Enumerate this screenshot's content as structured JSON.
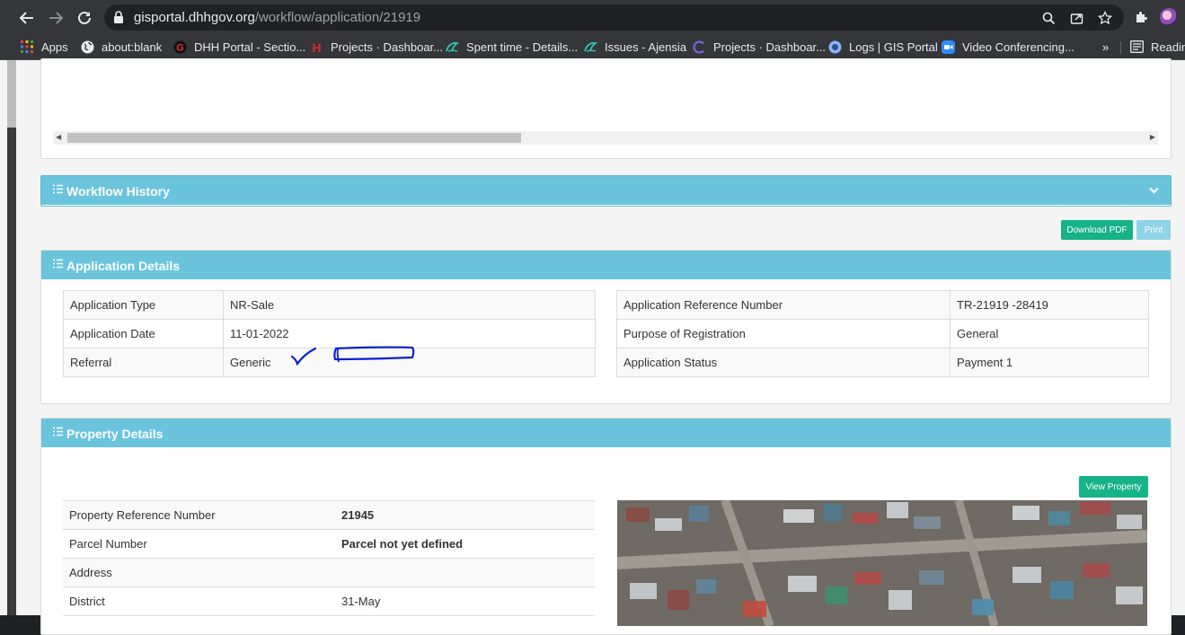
{
  "browser": {
    "url_domain": "gisportal.dhhgov.org",
    "url_path": "/workflow/application/21919",
    "bookmarks": [
      {
        "label": "Apps",
        "icon": "apps-grid-icon"
      },
      {
        "label": "about:blank",
        "icon": "globe-icon"
      },
      {
        "label": "DHH Portal - Sectio...",
        "icon": "dhh-portal-icon"
      },
      {
        "label": "Projects · Dashboar...",
        "icon": "gitlab-red-icon"
      },
      {
        "label": "Spent time - Details...",
        "icon": "ajensia-icon"
      },
      {
        "label": "Issues - Ajensia",
        "icon": "ajensia-icon"
      },
      {
        "label": "Projects · Dashboar...",
        "icon": "purple-c-icon"
      },
      {
        "label": "Logs | GIS Portal",
        "icon": "gis-portal-icon"
      },
      {
        "label": "Video Conferencing...",
        "icon": "zoom-icon"
      }
    ],
    "overflow": "»",
    "reading_list": "Reading"
  },
  "workflow": {
    "title": "Workflow History"
  },
  "actions": {
    "download_pdf": "Download PDF",
    "print": "Print"
  },
  "application": {
    "title": "Application Details",
    "left": [
      {
        "label": "Application Type",
        "value": "NR-Sale"
      },
      {
        "label": "Application Date",
        "value": "11-01-2022"
      },
      {
        "label": "Referral",
        "value": "Generic"
      }
    ],
    "right": [
      {
        "label": "Application Reference Number",
        "value": "TR-21919 -28419"
      },
      {
        "label": "Purpose of Registration",
        "value": "General"
      },
      {
        "label": "Application Status",
        "value": "Payment 1"
      }
    ]
  },
  "property": {
    "title": "Property Details",
    "view_button": "View Property",
    "rows": [
      {
        "label": "Property Reference Number",
        "value": "21945"
      },
      {
        "label": "Parcel Number",
        "value": "Parcel not yet defined"
      },
      {
        "label": "Address",
        "value": ""
      },
      {
        "label": "District",
        "value": "31-May"
      }
    ]
  },
  "colors": {
    "panel_header": "#6ac4dc",
    "button_green": "#16b388",
    "button_print": "#8fd3e8",
    "annotation_ink": "#0b1fd6"
  }
}
